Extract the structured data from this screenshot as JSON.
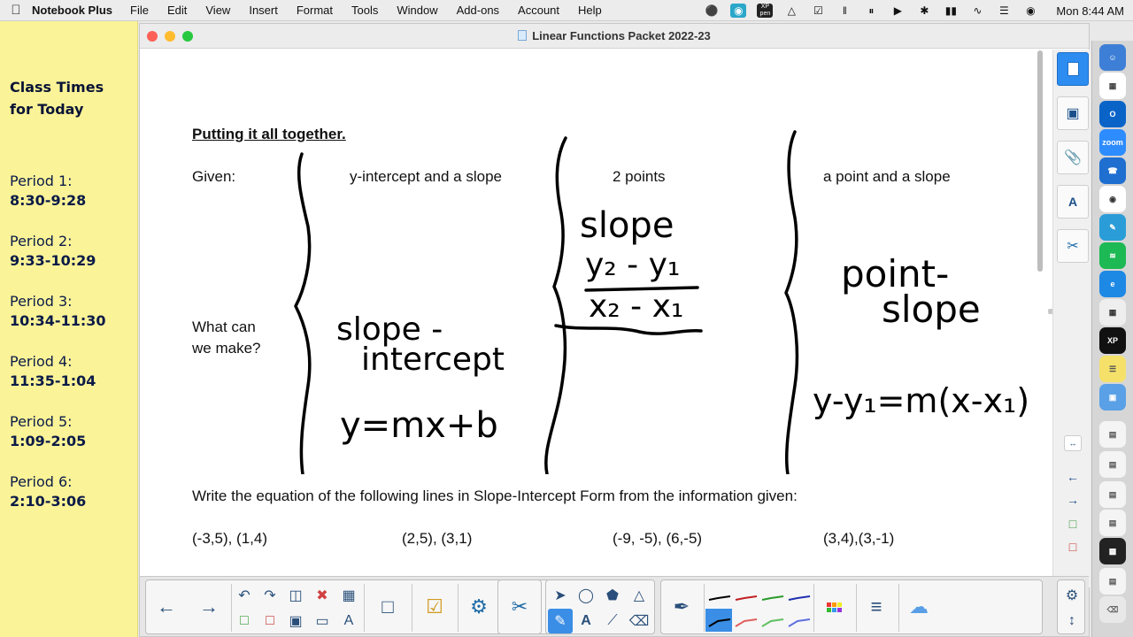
{
  "menubar": {
    "app_name": "Notebook Plus",
    "menus": [
      "File",
      "Edit",
      "View",
      "Insert",
      "Format",
      "Tools",
      "Window",
      "Add-ons",
      "Account",
      "Help"
    ],
    "xp_pen_label_top": "XP",
    "xp_pen_label_bottom": "pen",
    "clock": "Mon  8:44 AM"
  },
  "sticky": {
    "heading_line1": "Class Times",
    "heading_line2": "for Today",
    "periods": [
      {
        "label": "Period 1:",
        "time": "8:30-9:28"
      },
      {
        "label": "Period 2:",
        "time": "9:33-10:29"
      },
      {
        "label": "Period 3:",
        "time": "10:34-11:30"
      },
      {
        "label": "Period 4:",
        "time": "11:35-1:04"
      },
      {
        "label": "Period 5:",
        "time": "1:09-2:05"
      },
      {
        "label": "Period 6:",
        "time": "2:10-3:06"
      }
    ]
  },
  "window": {
    "title": "Linear Functions Packet 2022-23"
  },
  "page": {
    "section_title": "Putting it all together.",
    "given_label": "Given:",
    "what_line1": "What can",
    "what_line2": "we make?",
    "col1_header": "y-intercept and a slope",
    "col2_header": "2 points",
    "col3_header": "a point and a slope",
    "handwriting": {
      "col1_form_line1": "slope -",
      "col1_form_line2": "intercept",
      "col1_equation": "y=mx+b",
      "col2_label": "slope",
      "col2_numerator": "y₂ - y₁",
      "col2_denominator": "x₂ - x₁",
      "col3_form_line1": "point-",
      "col3_form_line2": "slope",
      "col3_equation": "y-y₁=m(x-x₁)"
    },
    "instruction": "Write the equation of the following lines in Slope-Intercept Form from the information given:",
    "problems": [
      "(-3,5), (1,4)",
      "(2,5), (3,1)",
      "(-9, -5), (6,-5)",
      "(3,4),(3,-1)"
    ]
  },
  "colors": {
    "sticky": "#fbf397",
    "sticky_text": "#0b1b48",
    "active_tab": "#2d8cf0",
    "selected_tool": "#3a8ee6"
  }
}
